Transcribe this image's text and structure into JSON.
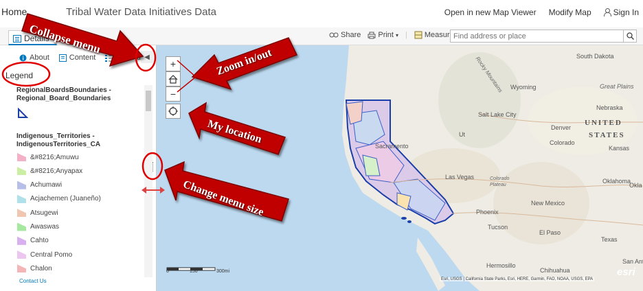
{
  "header": {
    "home": "Home",
    "title": "Tribal Water Data Initiatives Data",
    "links": [
      "Open in new Map Viewer",
      "Modify Map",
      "Sign In"
    ]
  },
  "toolbar": {
    "details_tab": "Details",
    "basemap_tab": "B",
    "share": "Share",
    "print": "Print",
    "measure": "Measure",
    "search_placeholder": "Find address or place"
  },
  "sidebar": {
    "tabs": [
      "About",
      "Content",
      "Legend"
    ],
    "legend_heading": "Legend",
    "layers": [
      {
        "name": "RegionalBoardsBoundaries - Regional_Board_Boundaries"
      },
      {
        "name": "Indigenous_Territories - IndigenousTerritories_CA"
      }
    ],
    "legend_items": [
      {
        "label": "&#8216;Amuwu",
        "color": "#f3b0c6"
      },
      {
        "label": "&#8216;Anyapax",
        "color": "#c9eea4"
      },
      {
        "label": "Achumawi",
        "color": "#b7bfe8"
      },
      {
        "label": "Acjachemen (Juaneño)",
        "color": "#b0e0ea"
      },
      {
        "label": "Atsugewi",
        "color": "#f0c6b0"
      },
      {
        "label": "Awaswas",
        "color": "#a7e8a1"
      },
      {
        "label": "Cahto",
        "color": "#d9b0ef"
      },
      {
        "label": "Central Pomo",
        "color": "#ecc5f0"
      },
      {
        "label": "Chalon",
        "color": "#f3b5b5"
      }
    ],
    "contact": "Contact Us"
  },
  "map": {
    "labels": [
      "South Dakota",
      "Great Plains",
      "Nebraska",
      "UNITED",
      "STATES",
      "Kansas",
      "Wyoming",
      "Salt Lake City",
      "Denver",
      "Colorado",
      "Oklahoma",
      "Okla",
      "Las Vegas",
      "Colorado Plateau",
      "New Mexico",
      "Phoenix",
      "Tucson",
      "El Paso",
      "Texas",
      "Hermosillo",
      "Chihuahua",
      "San Anto",
      "Sacramento",
      "Rocky Mountains",
      "Ut"
    ],
    "scale": {
      "ticks": [
        "0",
        "150",
        "300mi"
      ]
    },
    "attribution": "Esri, USGS | California State Parks, Esri, HERE, Garmin, FAO, NOAA, USGS, EPA",
    "logo": "esri"
  },
  "annotations": {
    "collapse": "Collapse menu",
    "zoom": "Zoom in/out",
    "location": "My location",
    "resize": "Change menu size"
  }
}
